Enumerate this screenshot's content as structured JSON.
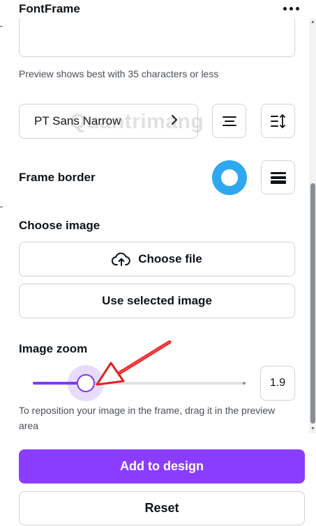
{
  "app": {
    "title": "FontFrame"
  },
  "header": {
    "more_icon": "more-horizontal-icon"
  },
  "preview_hint": "Preview shows best with 35 characters or less",
  "font_selector": {
    "value": "PT Sans Narrow",
    "chevron_icon": "chevron-right-icon"
  },
  "toolbar": {
    "align_icon": "text-align-center-icon",
    "spacing_icon": "line-spacing-icon"
  },
  "frame_border": {
    "label": "Frame border",
    "color": "#2fa7f1",
    "style_icon": "border-weight-icon"
  },
  "choose_image": {
    "label": "Choose image",
    "choose_file_label": "Choose file",
    "upload_icon": "cloud-upload-icon",
    "use_selected_label": "Use selected image"
  },
  "image_zoom": {
    "label": "Image zoom",
    "value": "1.9",
    "fill_fraction": 0.25,
    "accent": "#7d3cf0",
    "hint": "To reposition your image in the frame, drag it in the preview area"
  },
  "actions": {
    "add_label": "Add to design",
    "reset_label": "Reset",
    "primary_color": "#8b3dff"
  },
  "watermark": "Quantrimang"
}
